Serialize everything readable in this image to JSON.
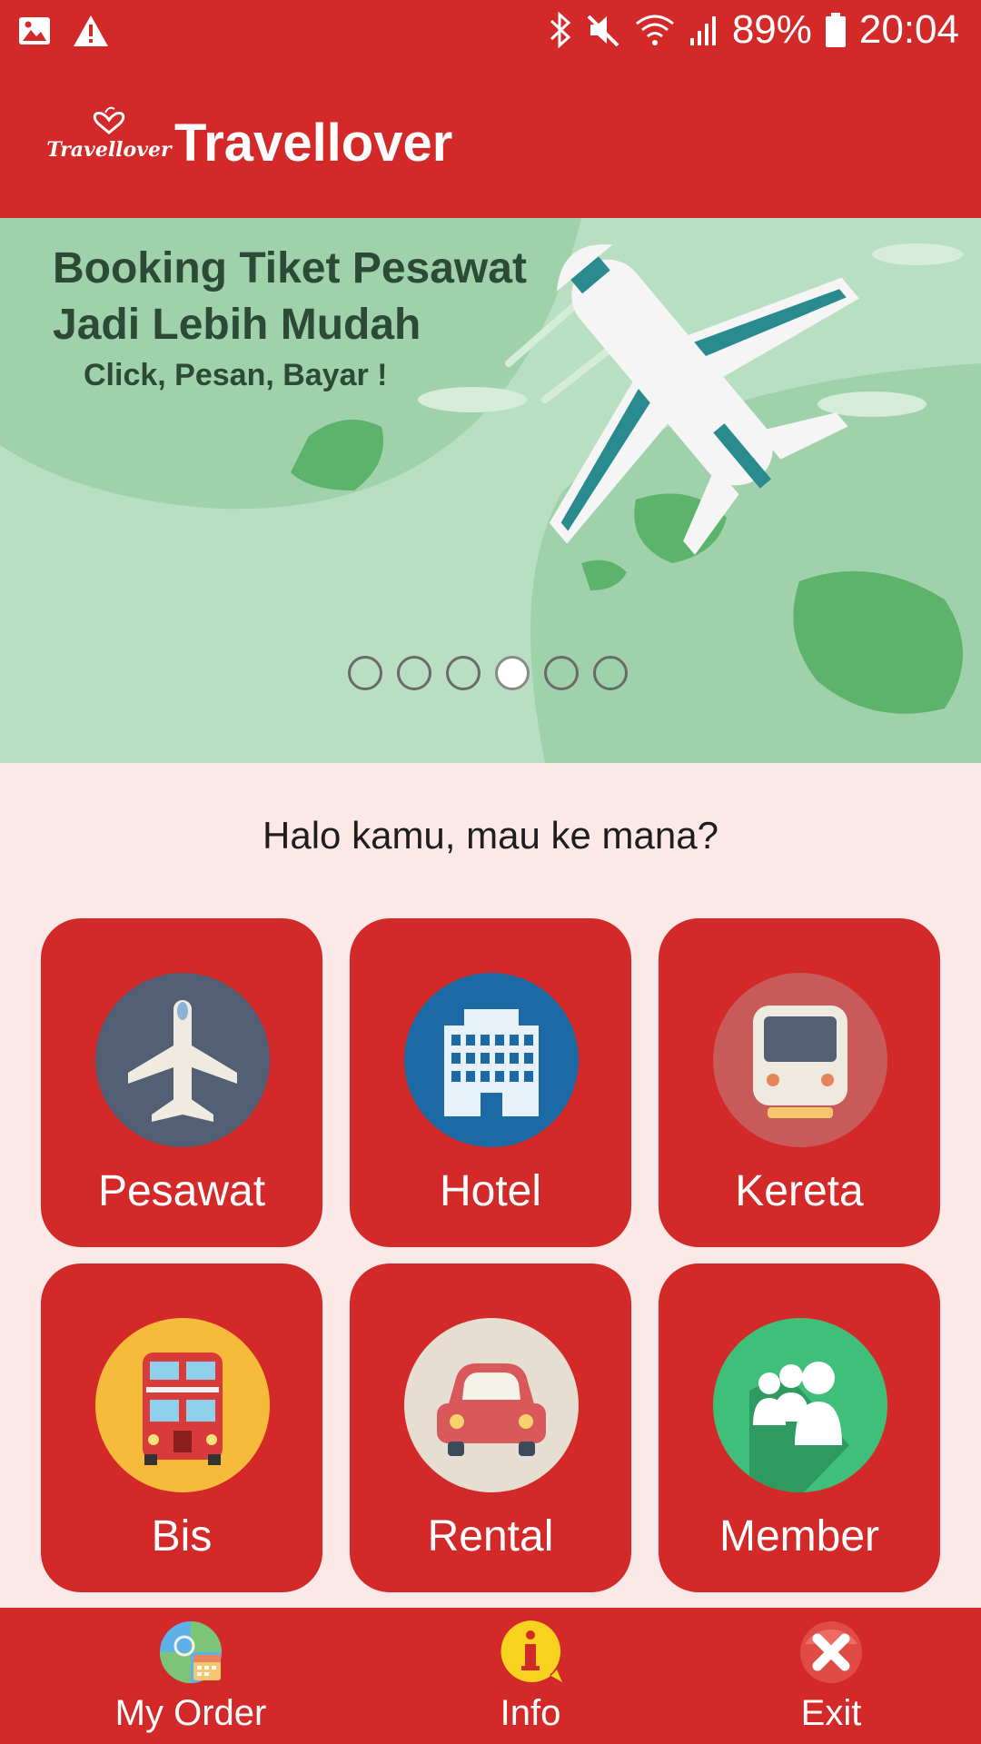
{
  "status_bar": {
    "battery": "89%",
    "time": "20:04"
  },
  "app_bar": {
    "logo_text": "Travellover",
    "title": "Travellover"
  },
  "banner": {
    "line1": "Booking Tiket Pesawat",
    "line2": "Jadi Lebih Mudah",
    "line3": "Click, Pesan, Bayar !",
    "slide_count": 6,
    "active_slide": 4
  },
  "greeting": "Halo kamu, mau ke mana?",
  "menu": [
    {
      "label": "Pesawat",
      "icon": "airplane-icon"
    },
    {
      "label": "Hotel",
      "icon": "hotel-icon"
    },
    {
      "label": "Kereta",
      "icon": "train-icon"
    },
    {
      "label": "Bis",
      "icon": "bus-icon"
    },
    {
      "label": "Rental",
      "icon": "car-icon"
    },
    {
      "label": "Member",
      "icon": "members-icon"
    }
  ],
  "bottom_nav": [
    {
      "label": "My Order",
      "icon": "order-icon"
    },
    {
      "label": "Info",
      "icon": "info-icon"
    },
    {
      "label": "Exit",
      "icon": "exit-icon"
    }
  ],
  "colors": {
    "primary": "#d32a29",
    "background": "#fde8e8",
    "banner_green": "#b8dfc2"
  }
}
